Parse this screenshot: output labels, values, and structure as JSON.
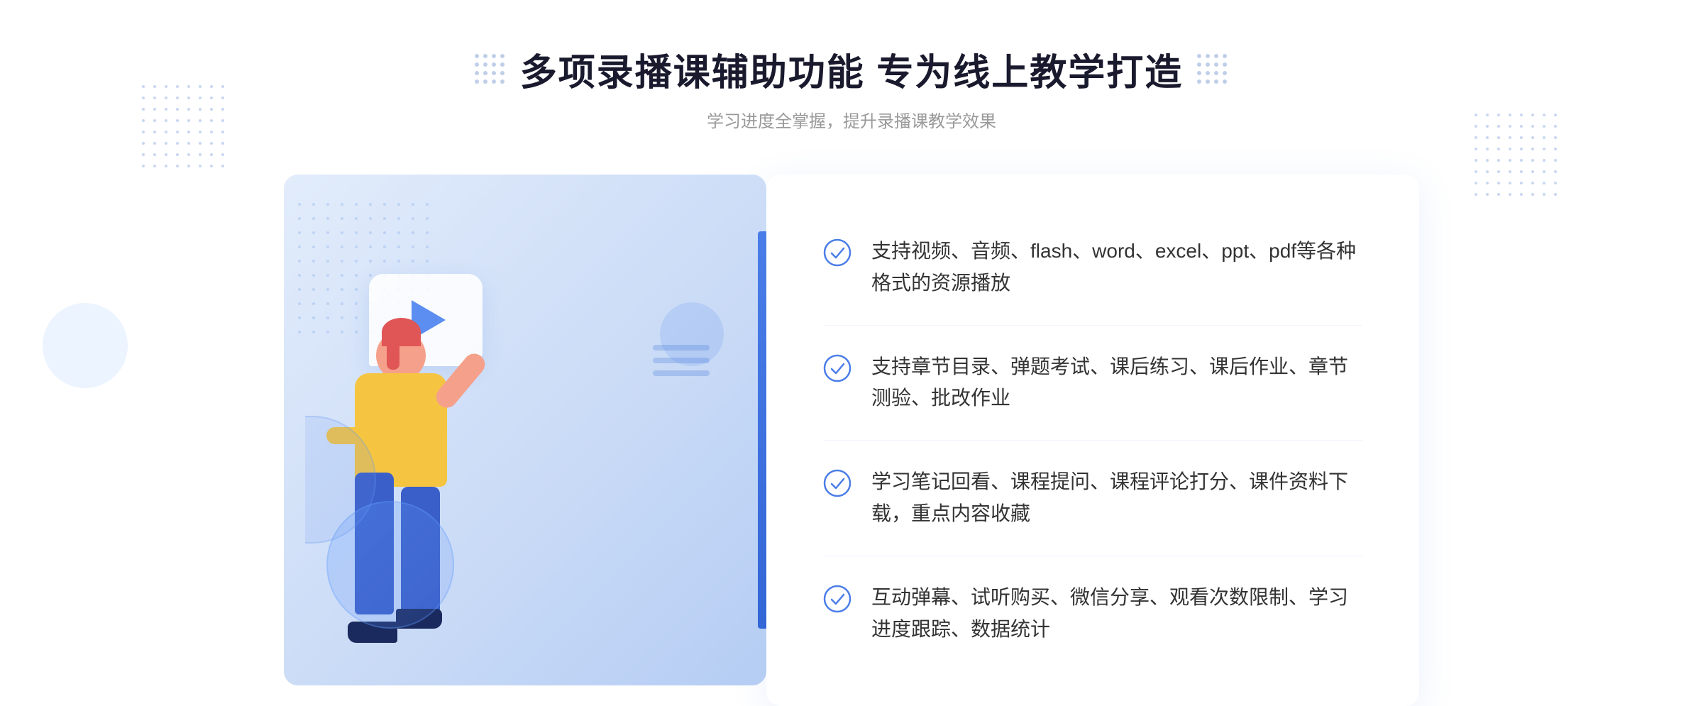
{
  "page": {
    "background": "#ffffff"
  },
  "header": {
    "main_title": "多项录播课辅助功能 专为线上教学打造",
    "sub_title": "学习进度全掌握，提升录播课教学效果"
  },
  "features": [
    {
      "id": 1,
      "text": "支持视频、音频、flash、word、excel、ppt、pdf等各种格式的资源播放"
    },
    {
      "id": 2,
      "text": "支持章节目录、弹题考试、课后练习、课后作业、章节测验、批改作业"
    },
    {
      "id": 3,
      "text": "学习笔记回看、课程提问、课程评论打分、课件资料下载，重点内容收藏"
    },
    {
      "id": 4,
      "text": "互动弹幕、试听购买、微信分享、观看次数限制、学习进度跟踪、数据统计"
    }
  ],
  "colors": {
    "primary_blue": "#4a7de8",
    "light_blue": "#3366d6",
    "check_color": "#4a7de8",
    "title_color": "#1a1a2e",
    "text_color": "#333333",
    "sub_color": "#999999"
  },
  "icons": {
    "check": "check-circle",
    "play": "play-triangle",
    "chevron_left": "«"
  }
}
